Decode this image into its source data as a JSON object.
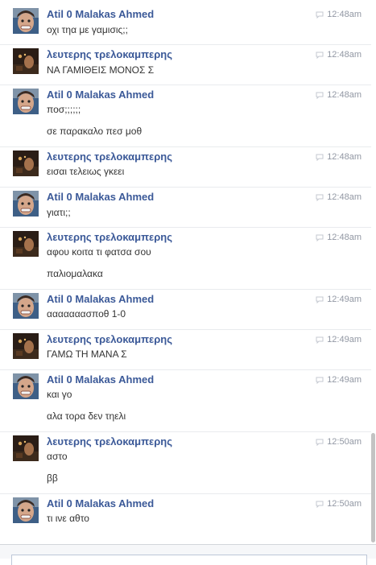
{
  "conversation": [
    {
      "author": "Atil 0 Malakas Ahmed",
      "avatar": "person-avatar-icon",
      "time": "12:48am",
      "messages": [
        "οχι τηα με γαμισις;;"
      ]
    },
    {
      "author": "λευτερης τρελοκαμπερης",
      "avatar": "dark-photo-avatar-icon",
      "time": "12:48am",
      "messages": [
        "ΝΑ ΓΑΜΙΘΕΙΣ ΜΟΝΟΣ Σ"
      ]
    },
    {
      "author": "Atil 0 Malakas Ahmed",
      "avatar": "person-avatar-icon",
      "time": "12:48am",
      "messages": [
        "ποσ;;;;;;",
        "σε παρακαλο πεσ μοθ"
      ]
    },
    {
      "author": "λευτερης τρελοκαμπερης",
      "avatar": "dark-photo-avatar-icon",
      "time": "12:48am",
      "messages": [
        "εισαι τελειως γκεει"
      ]
    },
    {
      "author": "Atil 0 Malakas Ahmed",
      "avatar": "person-avatar-icon",
      "time": "12:48am",
      "messages": [
        "γιατι;;"
      ]
    },
    {
      "author": "λευτερης τρελοκαμπερης",
      "avatar": "dark-photo-avatar-icon",
      "time": "12:48am",
      "messages": [
        "αφου κοιτα τι φατσα σου",
        "παλιομαλακα"
      ]
    },
    {
      "author": "Atil 0 Malakas Ahmed",
      "avatar": "person-avatar-icon",
      "time": "12:49am",
      "messages": [
        "ααααααασποθ 1-0"
      ]
    },
    {
      "author": "λευτερης τρελοκαμπερης",
      "avatar": "dark-photo-avatar-icon",
      "time": "12:49am",
      "messages": [
        "ΓΑΜΩ ΤΗ ΜΑΝΑ Σ"
      ]
    },
    {
      "author": "Atil 0 Malakas Ahmed",
      "avatar": "person-avatar-icon",
      "time": "12:49am",
      "messages": [
        "και γο",
        "αλα τορα δεν τηελι"
      ]
    },
    {
      "author": "λευτερης τρελοκαμπερης",
      "avatar": "dark-photo-avatar-icon",
      "time": "12:50am",
      "messages": [
        "αστο",
        "ββ"
      ]
    },
    {
      "author": "Atil 0 Malakas Ahmed",
      "avatar": "person-avatar-icon",
      "time": "12:50am",
      "messages": [
        "τι ινε αθτο"
      ]
    }
  ],
  "colors": {
    "author_link": "#3b5998",
    "timestamp": "#9197a3",
    "message_text": "#333333"
  }
}
